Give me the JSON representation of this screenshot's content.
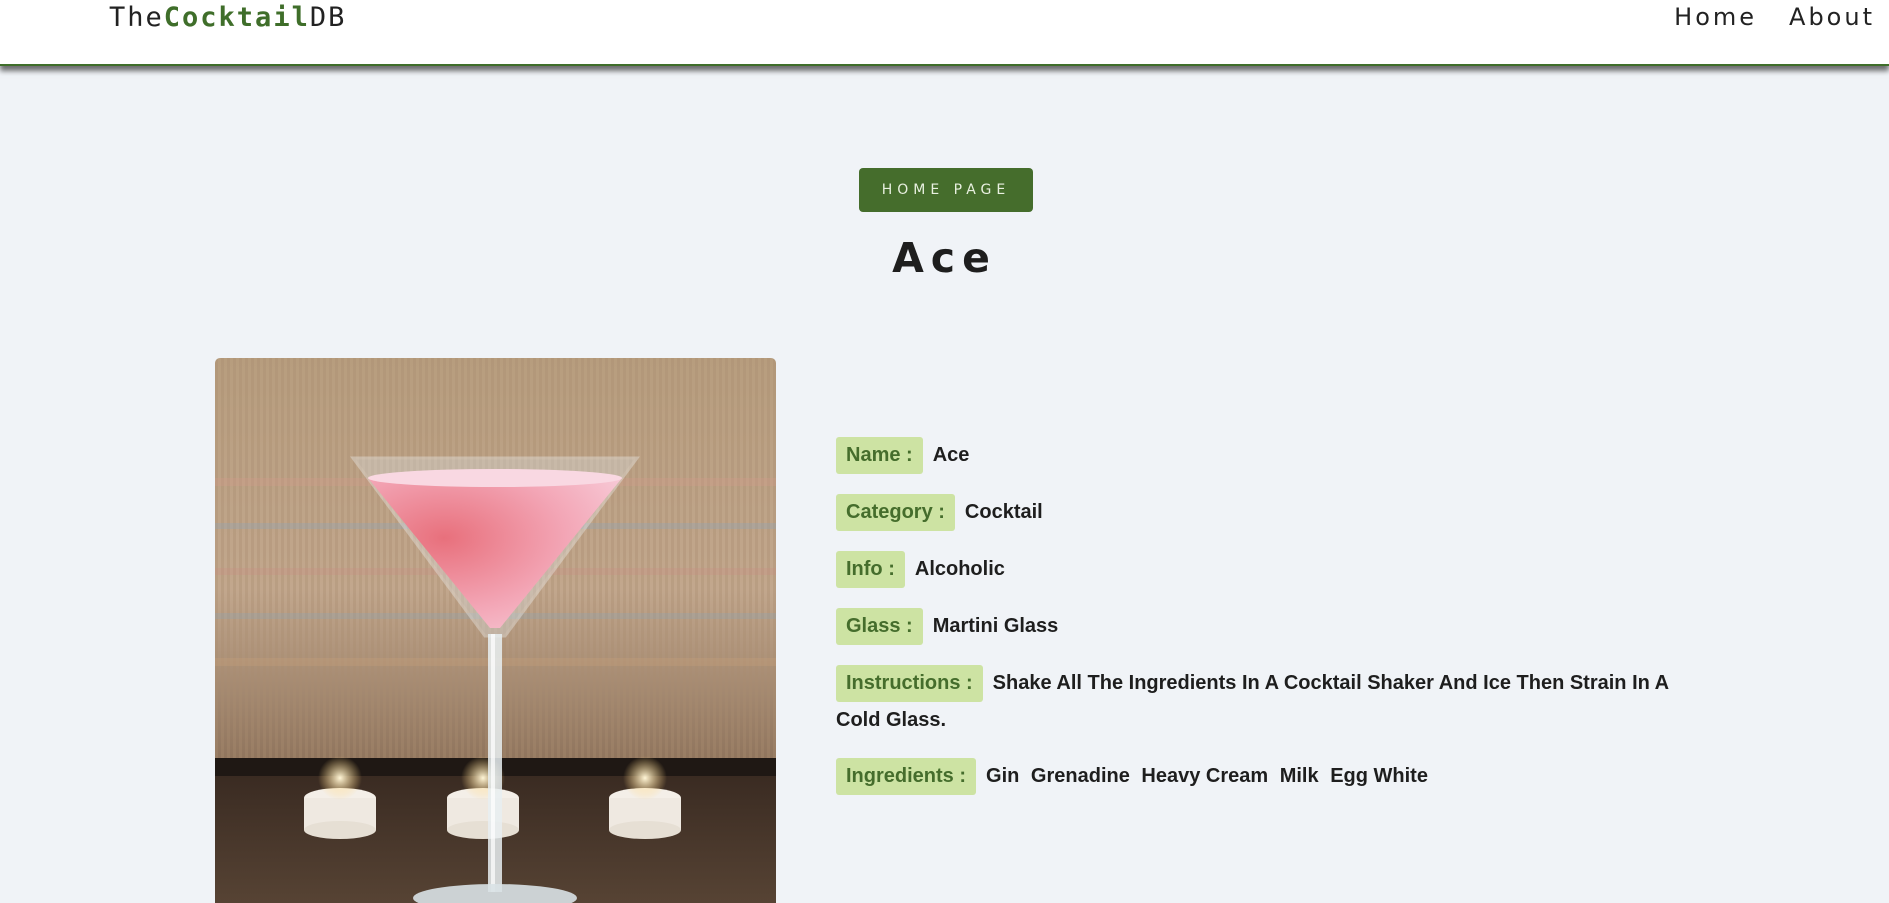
{
  "navbar": {
    "logo_prefix": "The",
    "logo_highlight": "Cocktail",
    "logo_suffix": "DB",
    "links": [
      "Home",
      "About"
    ]
  },
  "home_button": "HOME PAGE",
  "drink": {
    "title": "Ace",
    "fields": [
      {
        "label": "Name :",
        "value": "Ace"
      },
      {
        "label": "Category :",
        "value": "Cocktail"
      },
      {
        "label": "Info :",
        "value": "Alcoholic"
      },
      {
        "label": "Glass :",
        "value": "Martini Glass"
      },
      {
        "label": "Instructions :",
        "value": "Shake All The Ingredients In A Cocktail Shaker And Ice Then Strain In A Cold Glass."
      }
    ],
    "ingredients_label": "Ingredients :",
    "ingredients": [
      "Gin",
      "Grenadine",
      "Heavy Cream",
      "Milk",
      "Egg White"
    ]
  },
  "colors": {
    "brand_green": "#456d2c",
    "label_bg": "#cde3a3",
    "page_bg": "#f0f3f7"
  }
}
